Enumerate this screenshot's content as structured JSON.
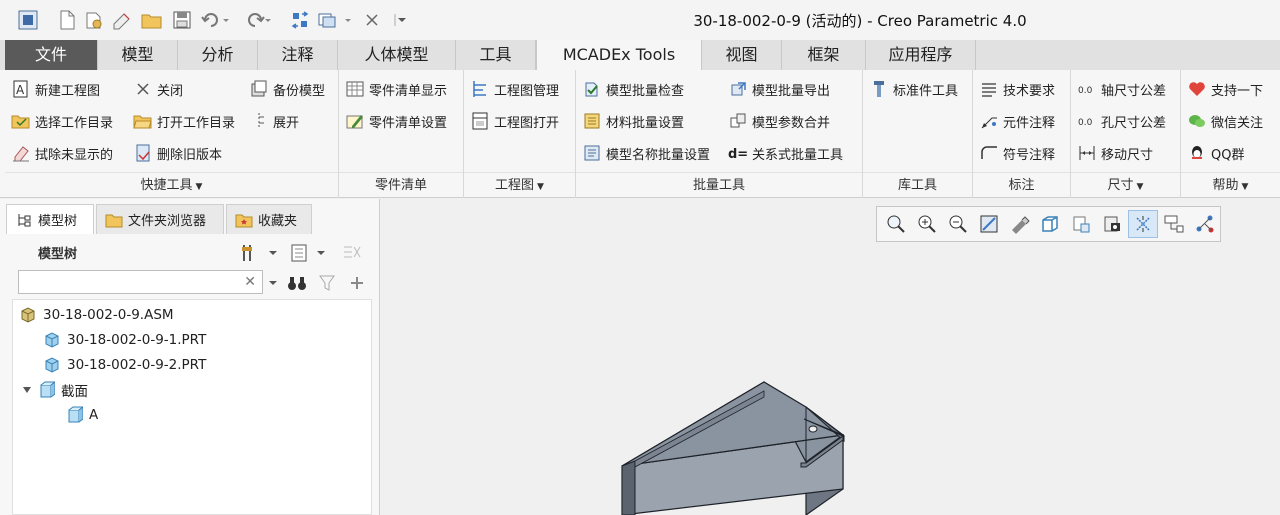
{
  "window": {
    "title": "30-18-002-0-9 (活动的) - Creo Parametric 4.0"
  },
  "quick_access": [
    "app-icon",
    "new-icon",
    "open-icon",
    "duplicate-icon",
    "folder-icon",
    "save-icon",
    "undo-icon",
    "redo-icon",
    "regenerate-icon",
    "windows-icon",
    "close-window-icon",
    "customize-icon"
  ],
  "tabs": [
    "文件",
    "模型",
    "分析",
    "注释",
    "人体模型",
    "工具",
    "MCADEx Tools",
    "视图",
    "框架",
    "应用程序"
  ],
  "active_tab": "MCADEx Tools",
  "ribbon": {
    "quick": {
      "label": "快捷工具",
      "items": [
        "新建工程图",
        "关闭",
        "备份模型",
        "选择工作目录",
        "打开工作目录",
        "展开",
        "拭除未显示的",
        "删除旧版本"
      ]
    },
    "bom": {
      "label": "零件清单",
      "items": [
        "零件清单显示",
        "零件清单设置"
      ]
    },
    "drawing": {
      "label": "工程图",
      "items": [
        "工程图管理",
        "工程图打开"
      ]
    },
    "batch": {
      "label": "批量工具",
      "items": [
        "模型批量检查",
        "模型批量导出",
        "材料批量设置",
        "模型参数合并",
        "模型名称批量设置",
        "关系式批量工具"
      ]
    },
    "library": {
      "label": "库工具",
      "items": [
        "标准件工具"
      ]
    },
    "annotate": {
      "label": "标注",
      "items": [
        "技术要求",
        "元件注释",
        "符号注释"
      ]
    },
    "dims": {
      "label": "尺寸",
      "items": [
        "轴尺寸公差",
        "孔尺寸公差",
        "移动尺寸"
      ]
    },
    "help": {
      "label": "帮助",
      "items": [
        "支持一下",
        "微信关注",
        "QQ群"
      ]
    }
  },
  "panel": {
    "tabs": [
      "模型树",
      "文件夹浏览器",
      "收藏夹"
    ],
    "tree_title": "模型树",
    "search_value": "",
    "tree": [
      {
        "label": "30-18-002-0-9.ASM",
        "level": 0
      },
      {
        "label": "30-18-002-0-9-1.PRT",
        "level": 1
      },
      {
        "label": "30-18-002-0-9-2.PRT",
        "level": 1
      },
      {
        "label": "截面",
        "level": 0,
        "expanded": true
      },
      {
        "label": "A",
        "level": 2
      }
    ]
  },
  "view_toolbar": [
    "zoom-fit-icon",
    "zoom-in-icon",
    "zoom-out-icon",
    "repaint-icon",
    "display-style-icon",
    "saved-views-icon",
    "view-manager-icon",
    "perspective-icon",
    "annotation-display-icon",
    "datum-display-icon",
    "spin-center-icon"
  ],
  "colors": {
    "file_tab": "#5a5a5a",
    "active_tab": "#f6f6f6",
    "model_face": "#8a94a0"
  }
}
